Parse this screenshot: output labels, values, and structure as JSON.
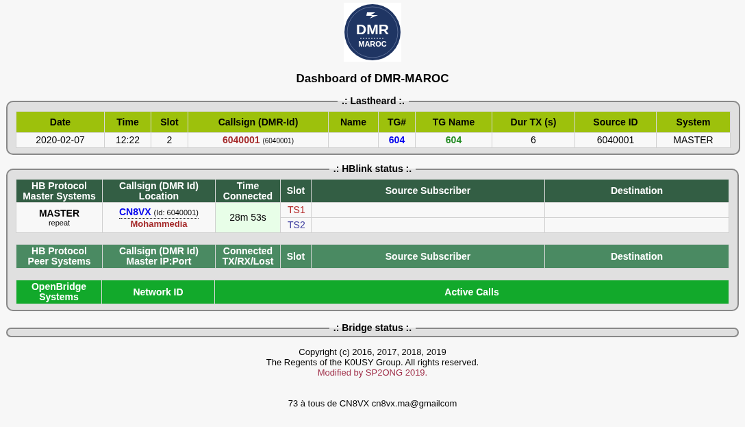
{
  "logo": {
    "line1": "DMR",
    "line2": "MAROC"
  },
  "title": "Dashboard of DMR-MAROC",
  "lastheard": {
    "legend": ".: Lastheard :.",
    "columns": [
      "Date",
      "Time",
      "Slot",
      "Callsign (DMR-Id)",
      "Name",
      "TG#",
      "TG Name",
      "Dur TX (s)",
      "Source ID",
      "System"
    ],
    "rows": [
      {
        "date": "2020-02-07",
        "time": "12:22",
        "slot": "2",
        "callsign": "6040001",
        "dmr_id": "(6040001)",
        "name": "",
        "tg": "604",
        "tg_name": "604",
        "dur_tx": "6",
        "source_id": "6040001",
        "system": "MASTER"
      }
    ]
  },
  "hblink": {
    "legend": ".: HBlink status :.",
    "master_columns": [
      [
        "HB Protocol",
        "Master Systems"
      ],
      [
        "Callsign (DMR Id)",
        "Location"
      ],
      [
        "Time",
        "Connected"
      ],
      [
        "Slot"
      ],
      [
        "Source Subscriber"
      ],
      [
        "Destination"
      ]
    ],
    "masters": [
      {
        "system": "MASTER",
        "mode": "repeat",
        "callsign": "CN8VX",
        "id": "(Id: 6040001)",
        "location": "Mohammedia",
        "time_connected": "28m 53s",
        "slots": [
          {
            "label": "TS1",
            "color": "#b22222"
          },
          {
            "label": "TS2",
            "color": "#4040a0"
          }
        ]
      }
    ],
    "peer_columns": [
      [
        "HB Protocol",
        "Peer Systems"
      ],
      [
        "Callsign (DMR Id)",
        "Master IP:Port"
      ],
      [
        "Connected",
        "TX/RX/Lost"
      ],
      [
        "Slot"
      ],
      [
        "Source Subscriber"
      ],
      [
        "Destination"
      ]
    ],
    "openbridge_columns": [
      [
        "OpenBridge",
        "Systems"
      ],
      [
        "Network ID"
      ],
      [
        "Active Calls"
      ]
    ]
  },
  "bridge": {
    "legend": ".: Bridge status :."
  },
  "footer": {
    "copyright": "Copyright (c) 2016, 2017, 2018, 2019",
    "rights": "The Regents of the K0USY Group. All rights reserved.",
    "modified": "Modified by SP2ONG 2019.",
    "greeting": "73 à tous de CN8VX cn8vx.ma@gmailcom"
  }
}
